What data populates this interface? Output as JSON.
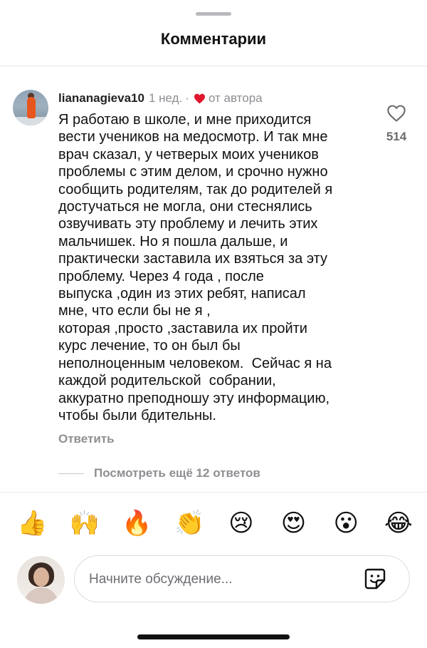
{
  "sheet": {
    "title": "Комментарии"
  },
  "comment": {
    "username": "liananagieva10",
    "time": "1 нед.",
    "separator": "·",
    "author_badge": "от автора",
    "text": "Я работаю в школе, и мне приходится\nвести учеников на медосмотр. И так мне\nврач сказал, у четверых моих учеников\nпроблемы с этим делом, и срочно нужно\nсообщить родителям, так до родителей я\nдостучаться не могла, они стеснялись\nозвучивать эту проблему и лечить этих\nмальчишек. Но я пошла дальше, и\nпрактически заставила их взяться за эту\nпроблему. Через 4 года , после\nвыпуска ,один из этих ребят, написал\nмне, что если бы не я ,\nкоторая ,просто ,заставила их пройти\nкурс лечение, то он был бы\nнеполноценным человеком.  Сейчас я на\nкаждой родительской  собрании,\nаккуратно преподношу эту информацию,\nчтобы были бдительны.",
    "like_count": "514",
    "reply_label": "Ответить",
    "more_replies_label": "Посмотреть ещё 12 ответов"
  },
  "reactions": [
    {
      "name": "thumbs-up",
      "glyph": "👍"
    },
    {
      "name": "raising-hands",
      "glyph": "🙌"
    },
    {
      "name": "fire",
      "glyph": "🔥"
    },
    {
      "name": "clapping-hands",
      "glyph": "👏"
    },
    {
      "name": "crying-face",
      "glyph": "😢"
    },
    {
      "name": "heart-eyes",
      "glyph": "😍"
    },
    {
      "name": "surprised-face",
      "glyph": "😮"
    },
    {
      "name": "tears-of-joy",
      "glyph": "😂"
    }
  ],
  "composer": {
    "placeholder": "Начните обсуждение..."
  },
  "colors": {
    "heart_red": "#e0152e",
    "muted_text": "#8e8e93"
  }
}
